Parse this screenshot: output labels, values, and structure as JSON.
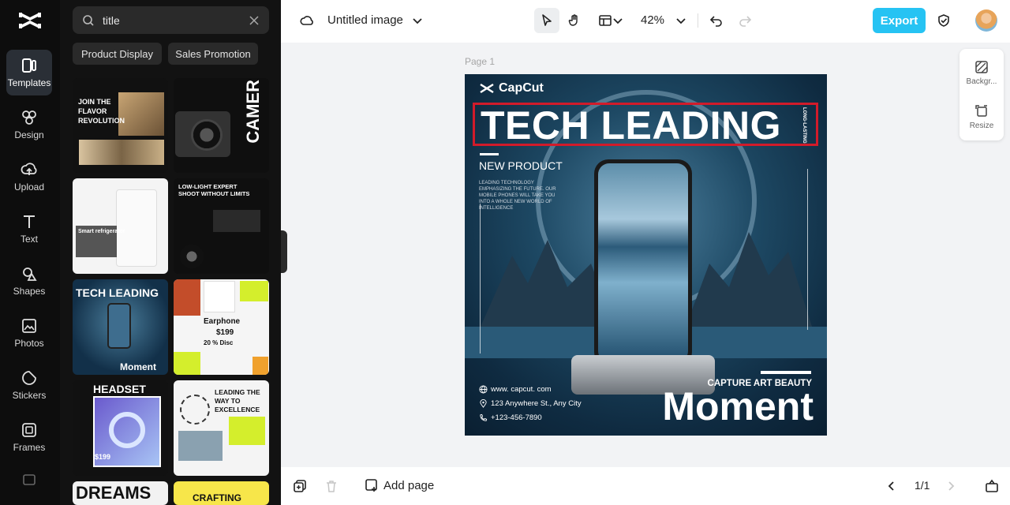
{
  "rail": {
    "items": [
      {
        "label": "Templates",
        "icon": "templates-icon",
        "active": true
      },
      {
        "label": "Design",
        "icon": "design-icon"
      },
      {
        "label": "Upload",
        "icon": "upload-icon"
      },
      {
        "label": "Text",
        "icon": "text-icon"
      },
      {
        "label": "Shapes",
        "icon": "shapes-icon"
      },
      {
        "label": "Photos",
        "icon": "photos-icon"
      },
      {
        "label": "Stickers",
        "icon": "stickers-icon"
      },
      {
        "label": "Frames",
        "icon": "frames-icon"
      }
    ]
  },
  "panel": {
    "search": {
      "value": "title"
    },
    "chips": [
      "Product Display",
      "Sales Promotion"
    ],
    "thumbs": {
      "t1": "JOIN THE FLAVOR REVOLUTION",
      "t2": "CAMER",
      "t3": "Smart refrigerator",
      "t4": "LOW-LIGHT EXPERT SHOOT WITHOUT LIMITS",
      "t5": "TECH LEADING",
      "t5b": "Moment",
      "t6": "Earphone",
      "t6b": "$199",
      "t6c": "20 % Disc",
      "t7": "HEADSET",
      "t7b": "$199",
      "t8": "LEADING THE WAY TO EXCELLENCE",
      "t9": "DREAMS",
      "t10": "CRAFTING"
    }
  },
  "topbar": {
    "title": "Untitled image",
    "zoom": "42%",
    "export_label": "Export"
  },
  "canvas": {
    "page_label": "Page 1",
    "design": {
      "brand": "CapCut",
      "headline": "TECH LEADING",
      "vertical_tag": "LONG-LASTING",
      "subhead": "NEW PRODUCT",
      "body": "LEADING TECHNOLOGY EMPHASIZING THE FUTURE. OUR MOBILE PHONES WILL TAKE YOU INTO A WHOLE NEW WORLD OF INTELLIGENCE",
      "website": "www. capcut. com",
      "address": "123 Anywhere St., Any City",
      "phone": "+123-456-7890",
      "capture": "CAPTURE ART  BEAUTY",
      "moment": "Moment"
    }
  },
  "right_tools": {
    "background": "Backgr...",
    "resize": "Resize"
  },
  "bottombar": {
    "add_page": "Add page",
    "pager": "1/1"
  },
  "colors": {
    "accent": "#26c3f3",
    "highlight_border": "#d21b2a",
    "rail_bg": "#0d0d0d",
    "panel_bg": "#121212"
  }
}
